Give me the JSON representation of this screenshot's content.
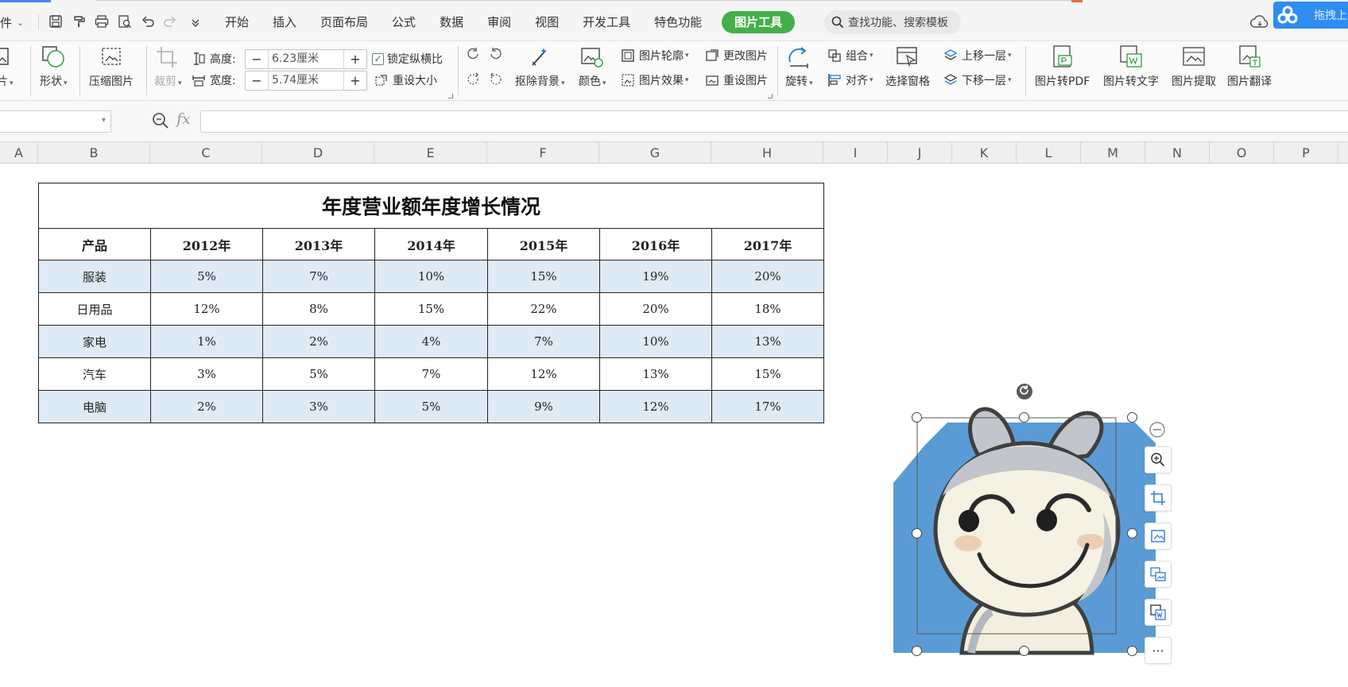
{
  "menubar": {
    "file_label": "文件",
    "tabs": [
      "开始",
      "插入",
      "页面布局",
      "公式",
      "数据",
      "审阅",
      "视图",
      "开发工具",
      "特色功能"
    ],
    "active_tab": "图片工具",
    "search_placeholder": "查找功能、搜索模板",
    "cloud_text": "拖拽上"
  },
  "ribbon": {
    "insert_picture": "图片",
    "shape": "形状",
    "compress": "压缩图片",
    "crop": "裁剪",
    "height_label": "高度:",
    "height_value": "6.23厘米",
    "width_label": "宽度:",
    "width_value": "5.74厘米",
    "lock_ratio": "锁定纵横比",
    "reset_size": "重设大小",
    "remove_bg": "抠除背景",
    "color": "颜色",
    "outline": "图片轮廓",
    "effect": "图片效果",
    "change_pic": "更改图片",
    "reset_pic": "重设图片",
    "rotate": "旋转",
    "group": "组合",
    "align": "对齐",
    "select_pane": "选择窗格",
    "bring_forward": "上移一层",
    "send_backward": "下移一层",
    "pic_to_pdf": "图片转PDF",
    "pic_to_text": "图片转文字",
    "pic_extract": "图片提取",
    "pic_translate": "图片翻译"
  },
  "formula": {
    "fx": "fx"
  },
  "columns": [
    "A",
    "B",
    "C",
    "D",
    "E",
    "F",
    "G",
    "H",
    "I",
    "J",
    "K",
    "L",
    "M",
    "N",
    "O",
    "P"
  ],
  "table": {
    "title": "年度营业额年度增长情况",
    "headers": [
      "产品",
      "2012年",
      "2013年",
      "2014年",
      "2015年",
      "2016年",
      "2017年"
    ],
    "rows": [
      [
        "服装",
        "5%",
        "7%",
        "10%",
        "15%",
        "19%",
        "20%"
      ],
      [
        "日用品",
        "12%",
        "8%",
        "15%",
        "22%",
        "20%",
        "18%"
      ],
      [
        "家电",
        "1%",
        "2%",
        "4%",
        "7%",
        "10%",
        "13%"
      ],
      [
        "汽车",
        "3%",
        "5%",
        "7%",
        "12%",
        "13%",
        "15%"
      ],
      [
        "电脑",
        "2%",
        "3%",
        "5%",
        "9%",
        "12%",
        "17%"
      ]
    ]
  },
  "picture": {
    "more_label": "···"
  },
  "colors": {
    "accent_green": "#43b049",
    "band_blue": "#deebf6",
    "picture_bg": "#5b9bd5"
  }
}
